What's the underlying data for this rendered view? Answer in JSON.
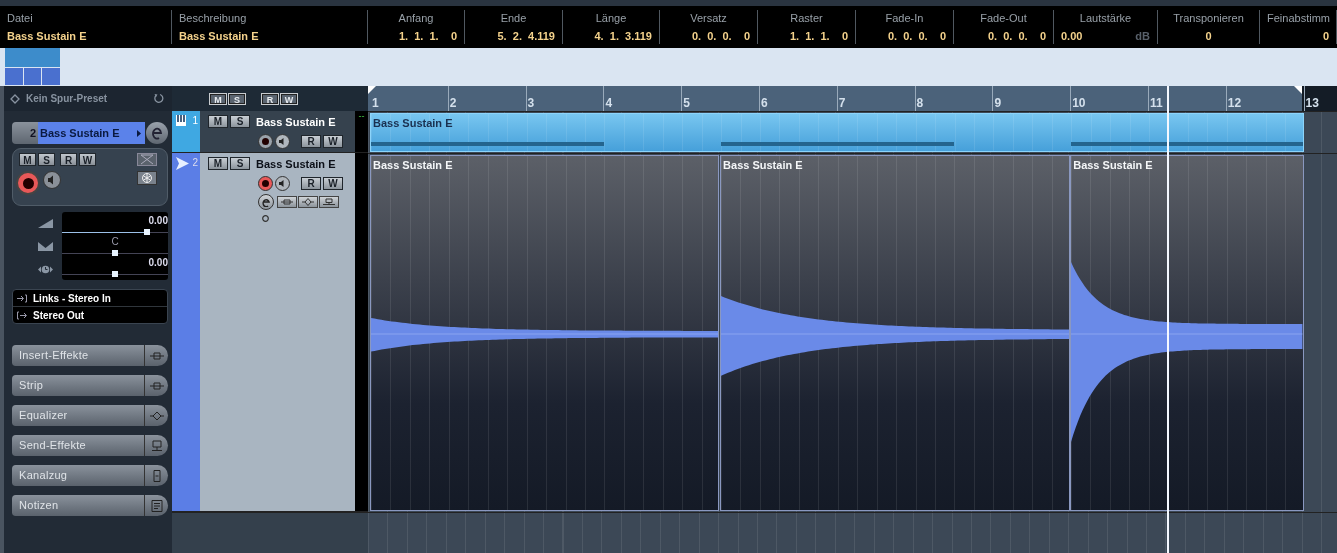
{
  "info_line": {
    "columns": [
      {
        "label": "Datei",
        "value": "Bass Sustain E"
      },
      {
        "label": "Beschreibung",
        "value": "Bass Sustain E"
      },
      {
        "label": "Anfang",
        "value": "1.  1.  1.    0"
      },
      {
        "label": "Ende",
        "value": "5.  2.  4.119"
      },
      {
        "label": "Länge",
        "value": "4.  1.  3.119"
      },
      {
        "label": "Versatz",
        "value": "0.  0.  0.    0"
      },
      {
        "label": "Raster",
        "value": "1.  1.  1.    0"
      },
      {
        "label": "Fade-In",
        "value": "0.  0.  0.    0"
      },
      {
        "label": "Fade-Out",
        "value": "0.  0.  0.    0"
      },
      {
        "label": "Lautstärke",
        "value": "0.00",
        "unit": "dB"
      },
      {
        "label": "Transponieren",
        "value": "0"
      },
      {
        "label": "Feinabstimm",
        "value": "0"
      }
    ]
  },
  "inspector": {
    "preset": "Kein Spur-Preset",
    "track_number": "2",
    "track_name": "Bass Sustain E",
    "record": true,
    "buttons": [
      "M",
      "S",
      "R",
      "W"
    ],
    "faders": [
      {
        "kind": "volume",
        "reading": "0.00",
        "level": 0.8
      },
      {
        "kind": "pan",
        "reading": "C",
        "level": 0.5
      },
      {
        "kind": "delay",
        "reading": "0.00",
        "level": 0.5
      }
    ],
    "routing": [
      {
        "kind": "input",
        "label": "Links - Stereo In"
      },
      {
        "kind": "output",
        "label": "Stereo Out"
      }
    ],
    "sections": [
      {
        "label": "Insert-Effekte",
        "kind": "insert"
      },
      {
        "label": "Strip",
        "kind": "strip"
      },
      {
        "label": "Equalizer",
        "kind": "eq"
      },
      {
        "label": "Send-Effekte",
        "kind": "send"
      },
      {
        "label": "Kanalzug",
        "kind": "channel"
      },
      {
        "label": "Notizen",
        "kind": "notes"
      }
    ]
  },
  "track_list": {
    "header_buttons": [
      "M",
      "S",
      "R",
      "W"
    ],
    "meter_reading": "--",
    "tracks": [
      {
        "number": "1",
        "name": "Bass Sustain E",
        "kind": "instrument",
        "selected": false,
        "record": false,
        "buttons": [
          "M",
          "S",
          "R",
          "W"
        ],
        "events": [
          {
            "name": "Bass Sustain E"
          }
        ]
      },
      {
        "number": "2",
        "name": "Bass Sustain E",
        "kind": "audio",
        "selected": true,
        "record": true,
        "buttons": [
          "M",
          "S",
          "R",
          "W"
        ],
        "events": [
          {
            "name": "Bass Sustain E"
          },
          {
            "name": "Bass Sustain E"
          },
          {
            "name": "Bass Sustain E"
          }
        ]
      }
    ]
  },
  "ruler": {
    "bars": [
      "1",
      "2",
      "3",
      "4",
      "5",
      "6",
      "7",
      "8",
      "9",
      "10",
      "11",
      "12",
      "13"
    ]
  }
}
